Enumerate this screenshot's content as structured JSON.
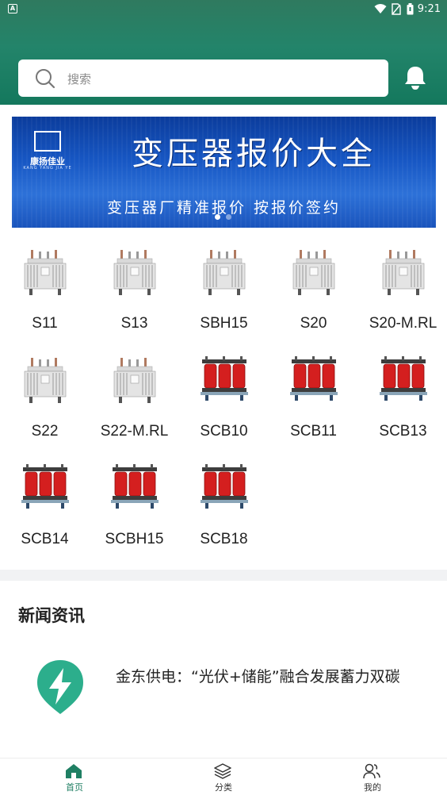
{
  "status_bar": {
    "time": "9:21",
    "app_badge": "A"
  },
  "search": {
    "placeholder": "搜索"
  },
  "banner": {
    "logo_text": "康扬佳业",
    "logo_sub": "KANG YANG JIA YE",
    "title": "变压器报价大全",
    "subtitle": "变压器厂精准报价  按报价签约",
    "active_dot": 0,
    "dot_count": 2
  },
  "products": [
    {
      "label": "S11",
      "type": "oil"
    },
    {
      "label": "S13",
      "type": "oil"
    },
    {
      "label": "SBH15",
      "type": "oil"
    },
    {
      "label": "S20",
      "type": "oil"
    },
    {
      "label": "S20-M.RL",
      "type": "oil"
    },
    {
      "label": "S22",
      "type": "oil"
    },
    {
      "label": "S22-M.RL",
      "type": "oil"
    },
    {
      "label": "SCB10",
      "type": "dry"
    },
    {
      "label": "SCB11",
      "type": "dry"
    },
    {
      "label": "SCB13",
      "type": "dry"
    },
    {
      "label": "SCB14",
      "type": "dry"
    },
    {
      "label": "SCBH15",
      "type": "dry"
    },
    {
      "label": "SCB18",
      "type": "dry"
    }
  ],
  "news": {
    "section_title": "新闻资讯",
    "items": [
      {
        "title": "金东供电：“光伏+储能”融合发展蓄力双碳",
        "icon": "lightning-icon"
      }
    ]
  },
  "tabbar": {
    "tabs": [
      {
        "label": "首页",
        "icon": "home-icon",
        "active": true
      },
      {
        "label": "分类",
        "icon": "layers-icon",
        "active": false
      },
      {
        "label": "我的",
        "icon": "users-icon",
        "active": false
      }
    ]
  },
  "colors": {
    "header": "#1f7f63",
    "accent": "#1f7f63",
    "banner": "#1757c4",
    "news_icon": "#2cae8c",
    "inactive": "#333333"
  }
}
